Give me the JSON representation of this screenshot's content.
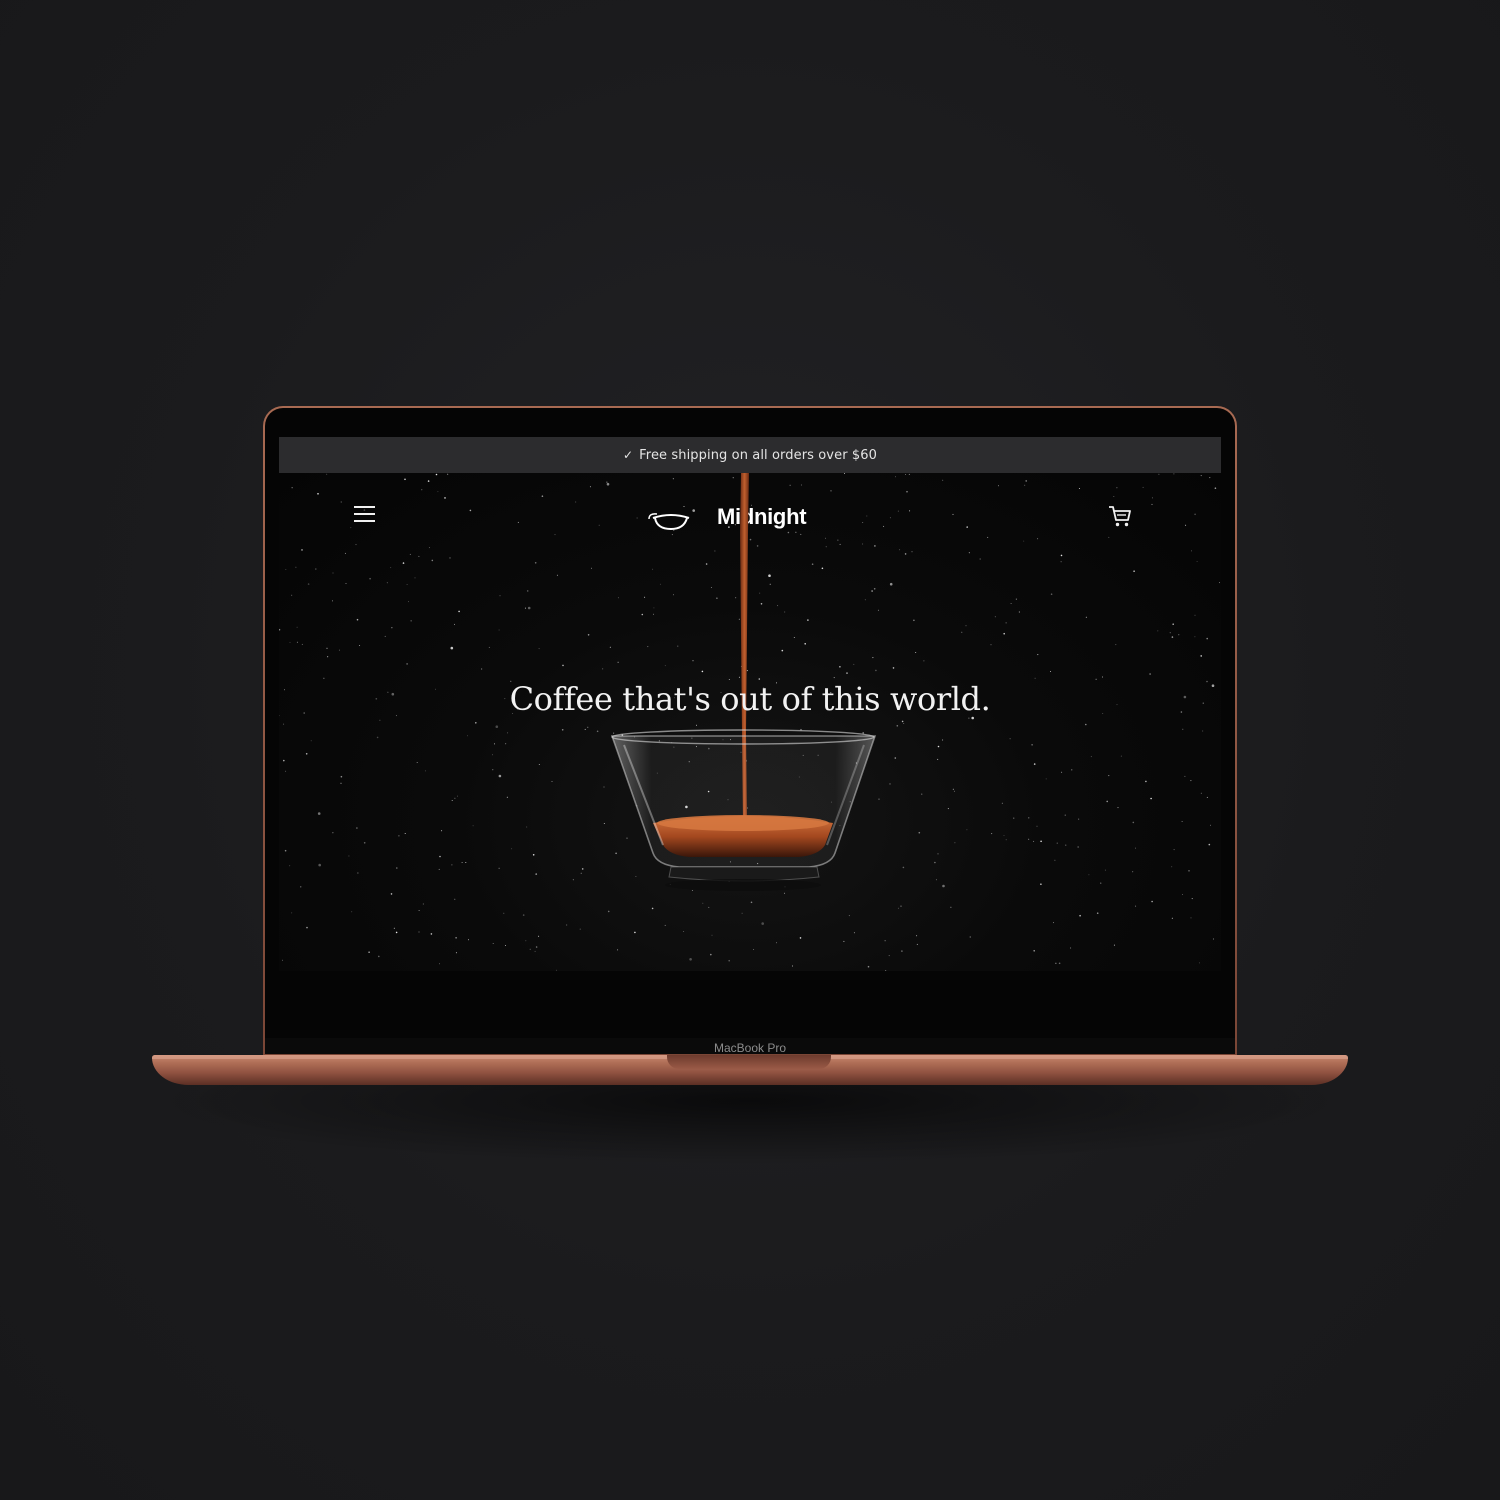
{
  "announcement": {
    "icon": "check-icon",
    "text": "Free shipping on all orders over $60"
  },
  "header": {
    "menu_icon": "hamburger-menu-icon",
    "logo_text": "Midnight",
    "logo_icon": "moon-cup-logo-icon",
    "cart_icon": "cart-icon"
  },
  "hero": {
    "headline": "Coffee that's out of this world.",
    "image": "espresso-pouring-into-glass-cup"
  },
  "device": {
    "label": "MacBook Pro",
    "color": "#a8684f"
  },
  "colors": {
    "page_background": "#1b1b1d",
    "announcement_bar": "#2c2c2e",
    "coffee": "#b4562a",
    "text": "#f2f2f2"
  }
}
